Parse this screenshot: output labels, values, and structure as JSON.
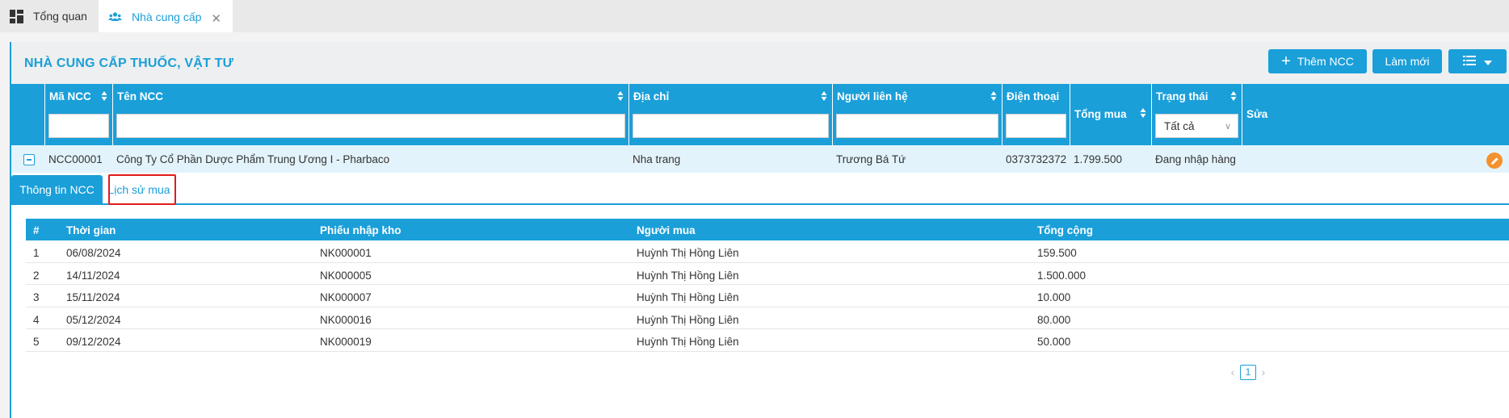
{
  "tabs": [
    {
      "label": "Tổng quan"
    },
    {
      "label": "Nhà cung cấp"
    }
  ],
  "panel": {
    "title": "NHÀ CUNG CẤP THUỐC, VẬT TƯ",
    "add_button": "Thêm NCC",
    "refresh_button": "Làm mới"
  },
  "grid": {
    "columns": {
      "ma_ncc": "Mã NCC",
      "ten_ncc": "Tên NCC",
      "dia_chi": "Địa chỉ",
      "nguoi_lien_he": "Người liên hệ",
      "dien_thoai": "Điện thoại",
      "tong_mua": "Tổng mua",
      "trang_thai": "Trạng thái",
      "sua": "Sửa"
    },
    "status_filter": "Tất cả",
    "row": {
      "ma_ncc": "NCC00001",
      "ten_ncc": "Công Ty Cổ Phần Dược Phẩm Trung Ương I - Pharbaco",
      "dia_chi": "Nha trang",
      "nguoi_lien_he": "Trương Bá Tứ",
      "dien_thoai": "0373732372",
      "tong_mua": "1.799.500",
      "trang_thai": "Đang nhập hàng"
    }
  },
  "detail_tabs": {
    "info": "Thông tin NCC",
    "history": "Lịch sử mua"
  },
  "history": {
    "headers": {
      "index": "#",
      "thoi_gian": "Thời gian",
      "phieu": "Phiếu nhập kho",
      "nguoi_mua": "Người mua",
      "tong_cong": "Tổng cộng"
    },
    "rows": [
      {
        "index": "1",
        "thoi_gian": "06/08/2024",
        "phieu": "NK000001",
        "nguoi_mua": "Huỳnh Thị Hồng Liên",
        "tong_cong": "159.500"
      },
      {
        "index": "2",
        "thoi_gian": "14/11/2024",
        "phieu": "NK000005",
        "nguoi_mua": "Huỳnh Thị Hồng Liên",
        "tong_cong": "1.500.000"
      },
      {
        "index": "3",
        "thoi_gian": "15/11/2024",
        "phieu": "NK000007",
        "nguoi_mua": "Huỳnh Thị Hồng Liên",
        "tong_cong": "10.000"
      },
      {
        "index": "4",
        "thoi_gian": "05/12/2024",
        "phieu": "NK000016",
        "nguoi_mua": "Huỳnh Thị Hồng Liên",
        "tong_cong": "80.000"
      },
      {
        "index": "5",
        "thoi_gian": "09/12/2024",
        "phieu": "NK000019",
        "nguoi_mua": "Huỳnh Thị Hồng Liên",
        "tong_cong": "50.000"
      }
    ]
  },
  "pager": {
    "current_page": "1"
  },
  "colors": {
    "accent": "#1a9fd9",
    "edit": "#f5922e",
    "highlight": "#e01b1b"
  },
  "icons": [
    "dashboard-icon",
    "users-icon",
    "close-icon",
    "plus-icon",
    "list-icon",
    "caret-down-icon",
    "sort-icon",
    "collapse-icon",
    "edit-pencil-icon",
    "chevron-left-icon",
    "chevron-right-icon"
  ]
}
